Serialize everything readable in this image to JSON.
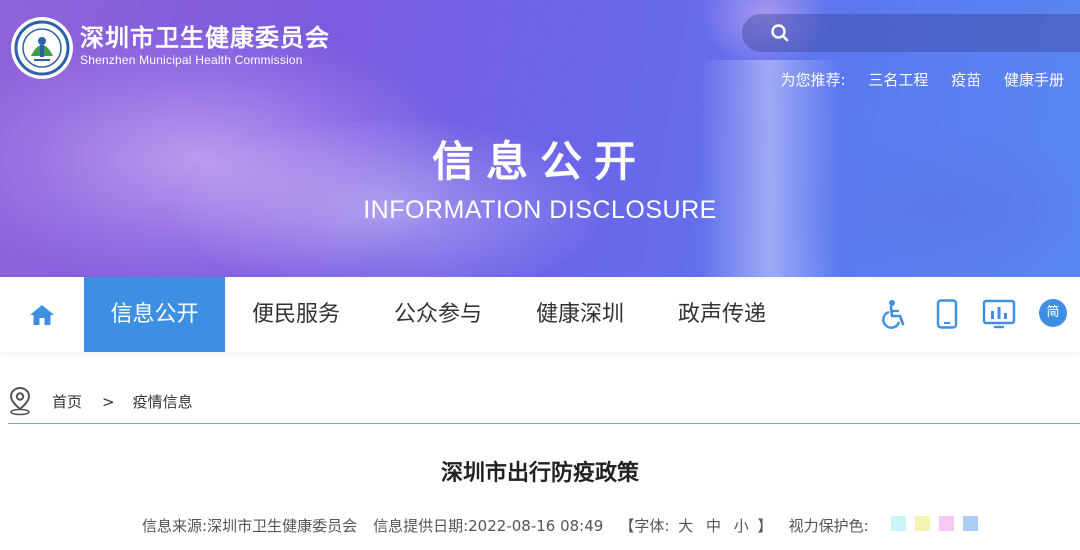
{
  "header": {
    "site_name_cn": "深圳市卫生健康委员会",
    "site_name_en": "Shenzhen Municipal Health Commission",
    "logo_icon": "shenzhen-health-commission-emblem",
    "search": {
      "icon": "search-icon",
      "placeholder": ""
    },
    "recommend": {
      "label": "为您推荐:",
      "links": [
        "三名工程",
        "疫苗",
        "健康手册"
      ]
    }
  },
  "banner": {
    "title_cn": "信息公开",
    "title_en": "INFORMATION DISCLOSURE"
  },
  "nav": {
    "home_icon": "home-icon",
    "items": [
      {
        "label": "信息公开",
        "active": true
      },
      {
        "label": "便民服务",
        "active": false
      },
      {
        "label": "公众参与",
        "active": false
      },
      {
        "label": "健康深圳",
        "active": false
      },
      {
        "label": "政声传递",
        "active": false
      }
    ],
    "tools": [
      "accessibility-icon",
      "mobile-icon",
      "data-screen-icon"
    ],
    "lang_button": "简"
  },
  "breadcrumb": {
    "icon": "location-pin-icon",
    "items": [
      "首页",
      "疫情信息"
    ],
    "separator": ">"
  },
  "article": {
    "title": "深圳市出行防疫政策",
    "meta": {
      "source_label": "信息来源:",
      "source": "深圳市卫生健康委员会",
      "date_label": "信息提供日期:",
      "date": "2022-08-16 08:49",
      "font_open": "【字体:",
      "font_sizes": [
        "大",
        "中",
        "小"
      ],
      "font_close": "】",
      "eye_label": "视力保护色:",
      "eye_colors": [
        "#c9f4f8",
        "#f6f2b4",
        "#f7c8f3",
        "#a9cdf3"
      ]
    }
  },
  "colors": {
    "accent": "#3d8fe3",
    "banner_start": "#8f63d8",
    "banner_end": "#5a86f2"
  }
}
